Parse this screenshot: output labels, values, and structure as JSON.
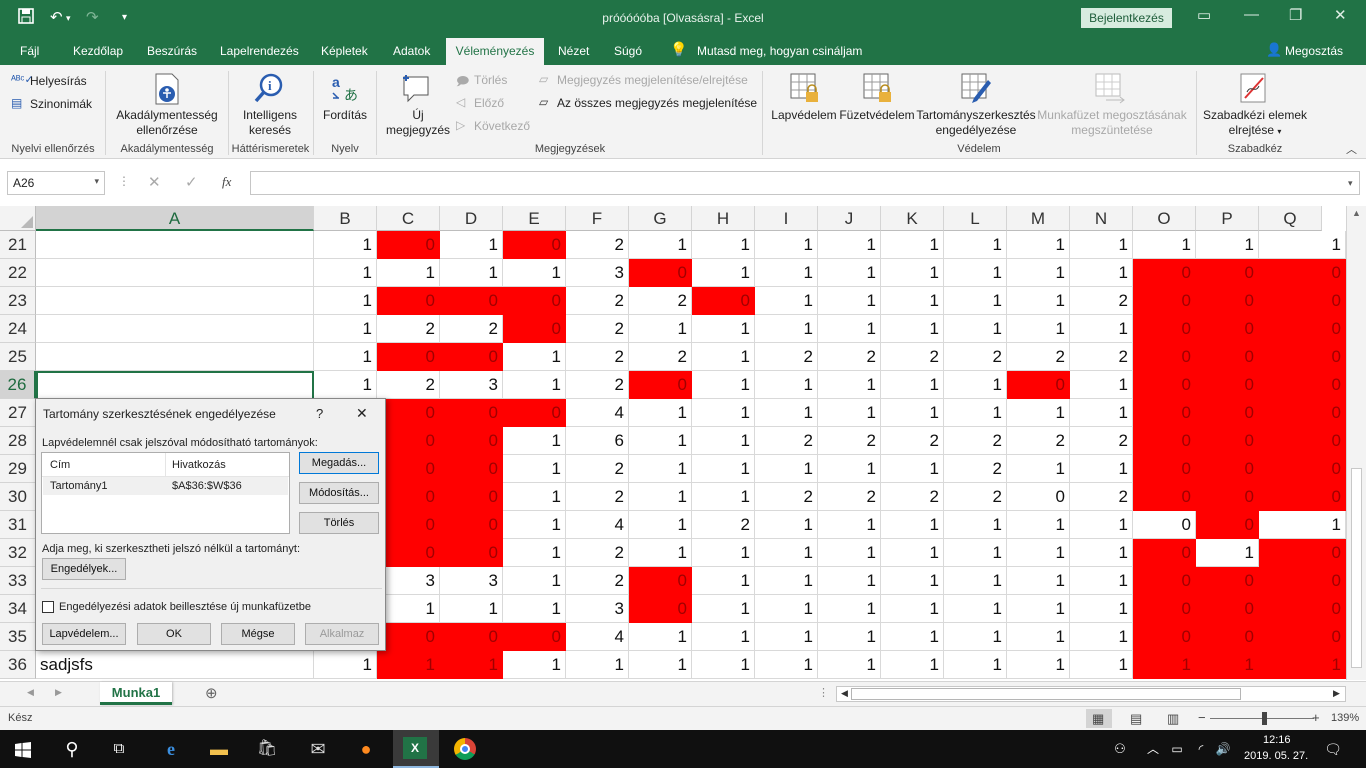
{
  "title_bar": {
    "title": "próóóóóba [Olvasásra] - Excel",
    "sign_in": "Bejelentkezés"
  },
  "ribbon_tabs": [
    "Fájl",
    "Kezdőlap",
    "Beszúrás",
    "Lapelrendezés",
    "Képletek",
    "Adatok",
    "Véleményezés",
    "Nézet",
    "Súgó"
  ],
  "active_tab": "Véleményezés",
  "tell_me": "Mutasd meg, hogyan csináljam",
  "share": "Megosztás",
  "ribbon": {
    "spelling": "Helyesírás",
    "thesaurus": "Szinonimák",
    "grp_proofing": "Nyelvi ellenőrzés",
    "accessibility_l1": "Akadálymentesség",
    "accessibility_l2": "ellenőrzése",
    "grp_accessibility": "Akadálymentesség",
    "smart_l1": "Intelligens",
    "smart_l2": "keresés",
    "grp_insights": "Háttérismeretek",
    "translate": "Fordítás",
    "grp_language": "Nyelv",
    "new_comment_l1": "Új",
    "new_comment_l2": "megjegyzés",
    "delete": "Törlés",
    "previous": "Előző",
    "next": "Következő",
    "show_hide_comment": "Megjegyzés megjelenítése/elrejtése",
    "show_all_comments": "Az összes megjegyzés megjelenítése",
    "grp_comments": "Megjegyzések",
    "protect_sheet": "Lapvédelem",
    "protect_workbook": "Füzetvédelem",
    "allow_edit_l1": "Tartományszerkesztés",
    "allow_edit_l2": "engedélyezése",
    "unshare_l1": "Munkafüzet megosztásának",
    "unshare_l2": "megszüntetése",
    "grp_protect": "Védelem",
    "ink_l1": "Szabadkézi elemek",
    "ink_l2": "elrejtése",
    "grp_ink": "Szabadkéz"
  },
  "formula_bar": {
    "name_box": "A26",
    "fx": "fx",
    "formula": ""
  },
  "columns": [
    "A",
    "B",
    "C",
    "D",
    "E",
    "F",
    "G",
    "H",
    "I",
    "J",
    "K",
    "L",
    "M",
    "N",
    "O",
    "P",
    "Q"
  ],
  "rows": [
    {
      "num": "21",
      "a": "",
      "vals": [
        "1",
        "0",
        "1",
        "0",
        "2",
        "1",
        "1",
        "1",
        "1",
        "1",
        "1",
        "1",
        "1",
        "1",
        "1",
        "1"
      ],
      "red": [
        0,
        1,
        0,
        1,
        0,
        0,
        0,
        0,
        0,
        0,
        0,
        0,
        0,
        0,
        0,
        0
      ]
    },
    {
      "num": "22",
      "a": "",
      "vals": [
        "1",
        "1",
        "1",
        "1",
        "3",
        "0",
        "1",
        "1",
        "1",
        "1",
        "1",
        "1",
        "1",
        "0",
        "0",
        "0"
      ],
      "red": [
        0,
        0,
        0,
        0,
        0,
        1,
        0,
        0,
        0,
        0,
        0,
        0,
        0,
        1,
        1,
        1
      ]
    },
    {
      "num": "23",
      "a": "",
      "vals": [
        "1",
        "0",
        "0",
        "0",
        "2",
        "2",
        "0",
        "1",
        "1",
        "1",
        "1",
        "1",
        "2",
        "0",
        "0",
        "0"
      ],
      "red": [
        0,
        1,
        1,
        1,
        0,
        0,
        1,
        0,
        0,
        0,
        0,
        0,
        0,
        1,
        1,
        1
      ]
    },
    {
      "num": "24",
      "a": "",
      "vals": [
        "1",
        "2",
        "2",
        "0",
        "2",
        "1",
        "1",
        "1",
        "1",
        "1",
        "1",
        "1",
        "1",
        "0",
        "0",
        "0"
      ],
      "red": [
        0,
        0,
        0,
        1,
        0,
        0,
        0,
        0,
        0,
        0,
        0,
        0,
        0,
        1,
        1,
        1
      ]
    },
    {
      "num": "25",
      "a": "",
      "vals": [
        "1",
        "0",
        "0",
        "1",
        "2",
        "2",
        "1",
        "2",
        "2",
        "2",
        "2",
        "2",
        "2",
        "0",
        "0",
        "0"
      ],
      "red": [
        0,
        1,
        1,
        0,
        0,
        0,
        0,
        0,
        0,
        0,
        0,
        0,
        0,
        1,
        1,
        1
      ]
    },
    {
      "num": "26",
      "a": "",
      "vals": [
        "1",
        "2",
        "3",
        "1",
        "2",
        "0",
        "1",
        "1",
        "1",
        "1",
        "1",
        "0",
        "1",
        "0",
        "0",
        "0"
      ],
      "red": [
        0,
        0,
        0,
        0,
        0,
        1,
        0,
        0,
        0,
        0,
        0,
        1,
        0,
        1,
        1,
        1
      ]
    },
    {
      "num": "27",
      "a": "",
      "vals": [
        "",
        "0",
        "0",
        "0",
        "4",
        "1",
        "1",
        "1",
        "1",
        "1",
        "1",
        "1",
        "1",
        "0",
        "0",
        "0"
      ],
      "red": [
        0,
        1,
        1,
        1,
        0,
        0,
        0,
        0,
        0,
        0,
        0,
        0,
        0,
        1,
        1,
        1
      ]
    },
    {
      "num": "28",
      "a": "",
      "vals": [
        "",
        "0",
        "0",
        "1",
        "6",
        "1",
        "1",
        "2",
        "2",
        "2",
        "2",
        "2",
        "2",
        "0",
        "0",
        "0"
      ],
      "red": [
        0,
        1,
        1,
        0,
        0,
        0,
        0,
        0,
        0,
        0,
        0,
        0,
        0,
        1,
        1,
        1
      ]
    },
    {
      "num": "29",
      "a": "",
      "vals": [
        "",
        "0",
        "0",
        "1",
        "2",
        "1",
        "1",
        "1",
        "1",
        "1",
        "2",
        "1",
        "1",
        "0",
        "0",
        "0"
      ],
      "red": [
        0,
        1,
        1,
        0,
        0,
        0,
        0,
        0,
        0,
        0,
        0,
        0,
        0,
        1,
        1,
        1
      ]
    },
    {
      "num": "30",
      "a": "",
      "vals": [
        "",
        "0",
        "0",
        "1",
        "2",
        "1",
        "1",
        "2",
        "2",
        "2",
        "2",
        "0",
        "2",
        "0",
        "0",
        "0"
      ],
      "red": [
        0,
        1,
        1,
        0,
        0,
        0,
        0,
        0,
        0,
        0,
        0,
        0,
        0,
        1,
        1,
        1
      ]
    },
    {
      "num": "31",
      "a": "",
      "vals": [
        "",
        "0",
        "0",
        "1",
        "4",
        "1",
        "2",
        "1",
        "1",
        "1",
        "1",
        "1",
        "1",
        "0",
        "0",
        "1"
      ],
      "red": [
        0,
        1,
        1,
        0,
        0,
        0,
        0,
        0,
        0,
        0,
        0,
        0,
        0,
        0,
        1,
        0
      ]
    },
    {
      "num": "32",
      "a": "",
      "vals": [
        "",
        "0",
        "0",
        "1",
        "2",
        "1",
        "1",
        "1",
        "1",
        "1",
        "1",
        "1",
        "1",
        "0",
        "1",
        "0"
      ],
      "red": [
        0,
        1,
        1,
        0,
        0,
        0,
        0,
        0,
        0,
        0,
        0,
        0,
        0,
        1,
        0,
        1
      ]
    },
    {
      "num": "33",
      "a": "",
      "vals": [
        "",
        "3",
        "3",
        "1",
        "2",
        "0",
        "1",
        "1",
        "1",
        "1",
        "1",
        "1",
        "1",
        "0",
        "0",
        "0"
      ],
      "red": [
        0,
        0,
        0,
        0,
        0,
        1,
        0,
        0,
        0,
        0,
        0,
        0,
        0,
        1,
        1,
        1
      ]
    },
    {
      "num": "34",
      "a": "",
      "vals": [
        "",
        "1",
        "1",
        "1",
        "3",
        "0",
        "1",
        "1",
        "1",
        "1",
        "1",
        "1",
        "1",
        "0",
        "0",
        "0"
      ],
      "red": [
        0,
        0,
        0,
        0,
        0,
        1,
        0,
        0,
        0,
        0,
        0,
        0,
        0,
        1,
        1,
        1
      ]
    },
    {
      "num": "35",
      "a": "",
      "vals": [
        "",
        "0",
        "0",
        "0",
        "4",
        "1",
        "1",
        "1",
        "1",
        "1",
        "1",
        "1",
        "1",
        "0",
        "0",
        "0"
      ],
      "red": [
        0,
        1,
        1,
        1,
        0,
        0,
        0,
        0,
        0,
        0,
        0,
        0,
        0,
        1,
        1,
        1
      ]
    },
    {
      "num": "36",
      "a": "sadjsfs",
      "vals": [
        "1",
        "1",
        "1",
        "1",
        "1",
        "1",
        "1",
        "1",
        "1",
        "1",
        "1",
        "1",
        "1",
        "1",
        "1",
        "1"
      ],
      "red": [
        0,
        1,
        1,
        0,
        0,
        0,
        0,
        0,
        0,
        0,
        0,
        0,
        0,
        1,
        1,
        1
      ]
    }
  ],
  "dialog": {
    "title": "Tartomány szerkesztésének engedélyezése",
    "help": "?",
    "close": "✕",
    "ranges_label": "Lapvédelemnél csak jelszóval módosítható tartományok:",
    "col_title": "Cím",
    "col_ref": "Hivatkozás",
    "range_name": "Tartomány1",
    "range_ref": "$A$36:$W$36",
    "btn_new": "Megadás...",
    "btn_modify": "Módosítás...",
    "btn_delete": "Törlés",
    "perm_label": "Adja meg, ki szerkesztheti jelszó nélkül a tartományt:",
    "btn_permissions": "Engedélyek...",
    "paste_checkbox": "Engedélyezési adatok beillesztése új munkafüzetbe",
    "btn_protect": "Lapvédelem...",
    "btn_ok": "OK",
    "btn_cancel": "Mégse",
    "btn_apply": "Alkalmaz"
  },
  "sheet_tab": "Munka1",
  "status": {
    "ready": "Kész",
    "zoom": "139%"
  },
  "taskbar": {
    "time": "12:16",
    "date": "2019. 05. 27."
  },
  "colors": {
    "excel_green": "#217346",
    "red_fill": "#ff0000"
  }
}
